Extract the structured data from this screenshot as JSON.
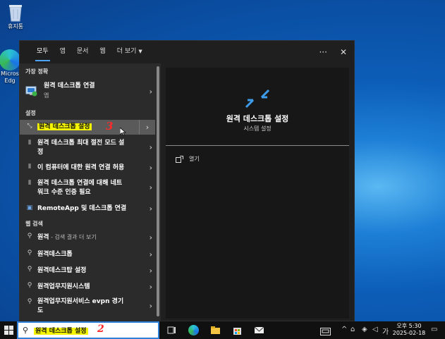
{
  "desktop": {
    "recycle_label": "휴지통",
    "edge_label_1": "Micros",
    "edge_label_2": "Edg"
  },
  "tabs": [
    {
      "label": "모두",
      "active": true
    },
    {
      "label": "앱"
    },
    {
      "label": "문서"
    },
    {
      "label": "웹"
    },
    {
      "label": "더 보기"
    }
  ],
  "tools": {
    "more": "···",
    "close": "✕"
  },
  "sections": {
    "best": "가장 정확",
    "settings": "설정",
    "web": "웹 검색"
  },
  "best_match": {
    "title": "원격 데스크톱 연결",
    "subtitle": "앱"
  },
  "settings_items": [
    {
      "label": "원격 데스크톱 설정",
      "selected": true
    },
    {
      "label_1": "원격 데스크톱 최대 절전 모드 설",
      "label_2": "정"
    },
    {
      "label": "이 컴퓨터에 대한 원격 연결 허용"
    },
    {
      "label_1": "원격 데스크톱 연결에 대해 네트",
      "label_2": "워크 수준 인증 필요"
    },
    {
      "label": "RemoteApp 및 데스크톱 연결"
    }
  ],
  "web_items": [
    {
      "label": "원격",
      "sub": " - 검색 결과 더 보기"
    },
    {
      "label": "원격데스크톱"
    },
    {
      "label": "원격데스크탑 설정"
    },
    {
      "label": "원격업무지원시스템"
    },
    {
      "label_1": "원격업무지원서비스 evpn 경기",
      "label_2": "도"
    }
  ],
  "annotations": {
    "three": "3",
    "two": "2"
  },
  "detail": {
    "title": "원격 데스크톱 설정",
    "subtitle": "시스템 설정",
    "open": "열기"
  },
  "taskbar": {
    "search_value": "원격 데스크톱 설정",
    "ime": "가",
    "time": "오후 5:30",
    "date": "2025-02-18",
    "colors": {
      "accent": "#2f7fd8",
      "highlight": "#f5f500"
    }
  }
}
